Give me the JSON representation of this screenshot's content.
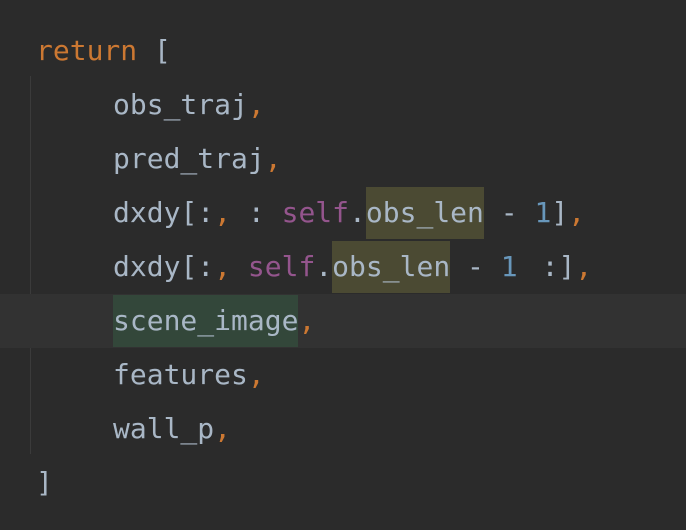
{
  "editor": {
    "lines": [
      {
        "keyword": "return",
        "bracket": "["
      },
      {
        "ident": "obs_traj",
        "comma": ","
      },
      {
        "ident": "pred_traj",
        "comma": ","
      },
      {
        "ident": "dxdy",
        "open": "[",
        "colon1": ":",
        "comma1": ",",
        "colon2": " :",
        "self": "self",
        "dot": ".",
        "attr": "obs_len",
        "minus": "-",
        "num": "1",
        "close": "]",
        "comma": ","
      },
      {
        "ident": "dxdy",
        "open": "[",
        "colon1": ":",
        "comma1": ",",
        "self": "self",
        "dot": ".",
        "attr": "obs_len",
        "minus": "-",
        "num": "1",
        "colon2": ":",
        "close": "]",
        "comma": ","
      },
      {
        "ident": "scene_image",
        "comma": ","
      },
      {
        "ident": "features",
        "comma": ","
      },
      {
        "ident": "wall_p",
        "comma": ","
      },
      {
        "bracket": "]"
      }
    ]
  },
  "colors": {
    "background": "#2b2b2b",
    "current_line": "#323232",
    "keyword": "#cc7832",
    "self": "#94558d",
    "number": "#6897bb",
    "text": "#a9b7c6",
    "usage_highlight": "#4b4a33",
    "caret_highlight": "#33473a",
    "warning_squiggle": "#b4a95a"
  }
}
